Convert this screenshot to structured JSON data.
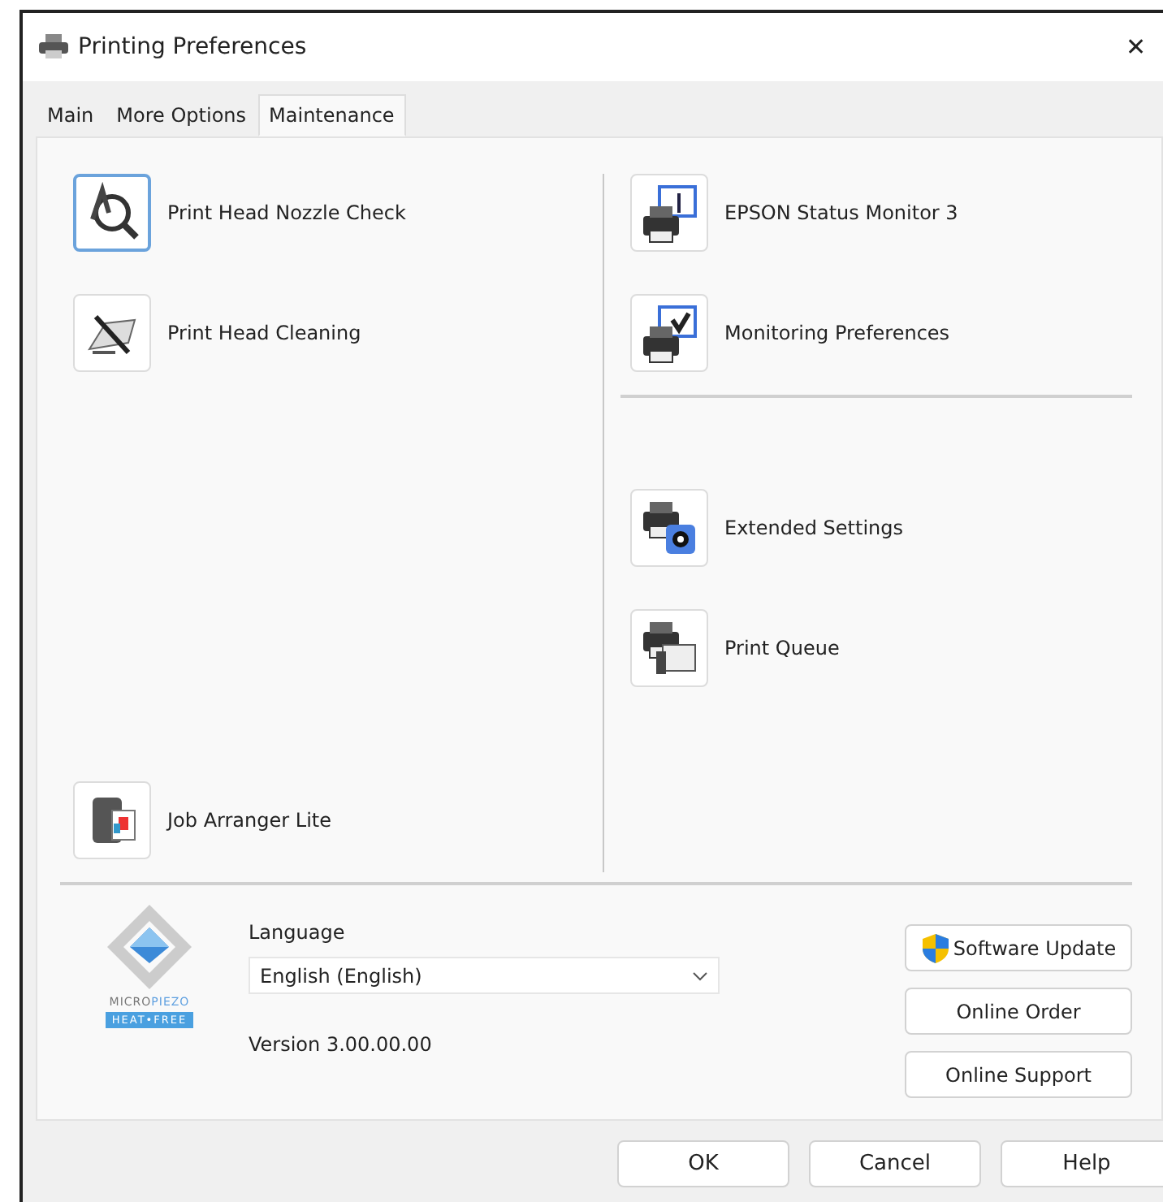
{
  "window": {
    "title": "Printing Preferences",
    "close": "✕"
  },
  "tabs": [
    {
      "label": "Main",
      "selected": false
    },
    {
      "label": "More Options",
      "selected": false
    },
    {
      "label": "Maintenance",
      "selected": true
    }
  ],
  "maintenance": {
    "left_tools": [
      {
        "label": "Print Head Nozzle Check",
        "kind": "nozzle",
        "focused": true
      },
      {
        "label": "Print Head Cleaning",
        "kind": "cleaning",
        "focused": false
      }
    ],
    "left_bottom_tools": [
      {
        "label": "Job Arranger Lite",
        "kind": "job",
        "focused": false
      }
    ],
    "right_tools_top": [
      {
        "label": "EPSON Status Monitor 3",
        "kind": "monitor",
        "focused": false
      },
      {
        "label": "Monitoring Preferences",
        "kind": "prefs",
        "focused": false
      }
    ],
    "right_tools_bottom": [
      {
        "label": "Extended Settings",
        "kind": "extended",
        "focused": false
      },
      {
        "label": "Print Queue",
        "kind": "queue",
        "focused": false
      }
    ]
  },
  "logo": {
    "line_1": "MICRO",
    "line_2": "PIEZO",
    "badge": "HEAT•FREE"
  },
  "language": {
    "label": "Language",
    "value": "English (English)"
  },
  "version": "Version 3.00.00.00",
  "side_buttons": [
    {
      "label": "Software Update",
      "kind": "shield"
    },
    {
      "label": "Online Order",
      "kind": "plain"
    },
    {
      "label": "Online Support",
      "kind": "plain"
    }
  ],
  "footer_buttons": [
    "OK",
    "Cancel",
    "Help"
  ]
}
